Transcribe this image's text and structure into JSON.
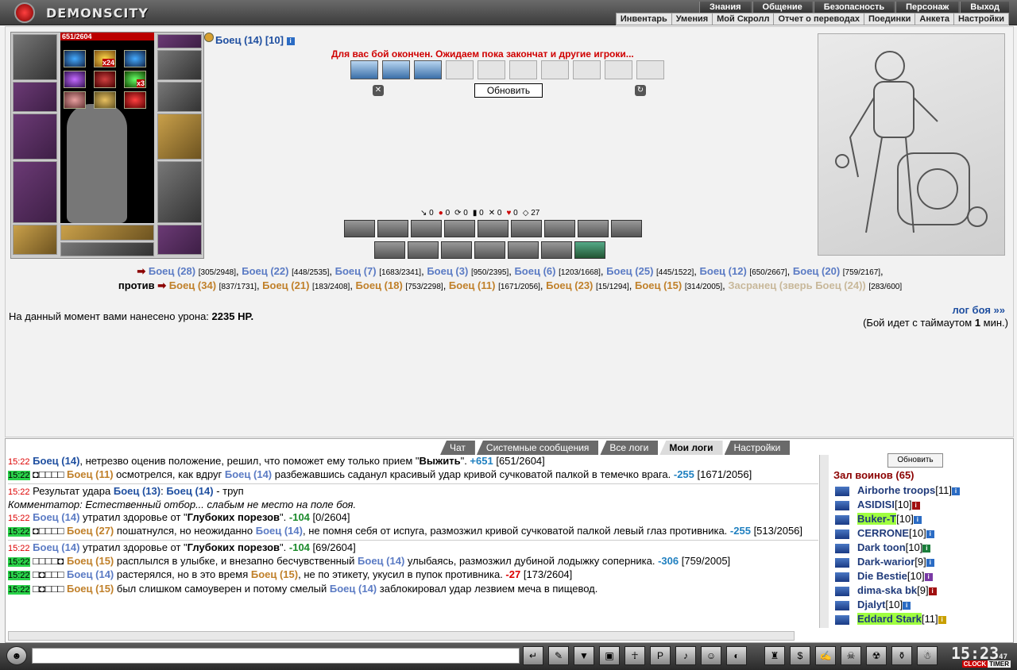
{
  "header": {
    "logo_text": "DEMONSCITY",
    "menu_top": [
      "Знания",
      "Общение",
      "Безопасность",
      "Персонаж",
      "Выход"
    ],
    "menu_bottom": [
      "Инвентарь",
      "Умения",
      "Мой Скролл",
      "Отчет о переводах",
      "Поединки",
      "Анкета",
      "Настройки"
    ]
  },
  "character": {
    "name": "Боец (14) [10]",
    "hp": "651/2604",
    "x24": "x24",
    "x3": "x3"
  },
  "battle": {
    "message": "Для вас бой окончен. Ожидаем пока закончат и другие игроки...",
    "refresh": "Обновить",
    "stats": [
      "0",
      "0",
      "0",
      "0",
      "0",
      "0",
      "27"
    ]
  },
  "teams": {
    "team1": [
      {
        "n": "Боец (28)",
        "h": "[305/2948]"
      },
      {
        "n": "Боец (22)",
        "h": "[448/2535]"
      },
      {
        "n": "Боец (7)",
        "h": "[1683/2341]"
      },
      {
        "n": "Боец (3)",
        "h": "[950/2395]"
      },
      {
        "n": "Боец (6)",
        "h": "[1203/1668]"
      },
      {
        "n": "Боец (25)",
        "h": "[445/1522]"
      },
      {
        "n": "Боец (12)",
        "h": "[650/2667]"
      },
      {
        "n": "Боец (20)",
        "h": "[759/2167]"
      }
    ],
    "versus": "против",
    "team2": [
      {
        "n": "Боец (34)",
        "h": "[837/1731]"
      },
      {
        "n": "Боец (21)",
        "h": "[183/2408]"
      },
      {
        "n": "Боец (18)",
        "h": "[753/2298]"
      },
      {
        "n": "Боец (11)",
        "h": "[1671/2056]"
      },
      {
        "n": "Боец (23)",
        "h": "[15/1294]"
      },
      {
        "n": "Боец (15)",
        "h": "[314/2005]"
      }
    ],
    "beast": {
      "n": "Засранец (зверь Боец (24))",
      "h": "[283/600]"
    }
  },
  "damage": {
    "label": "На данный момент вами нанесено урона:",
    "value": "2235 HP."
  },
  "log_link": "лог боя »»",
  "timeout": {
    "pre": "(Бой идет с таймаутом",
    "num": "1",
    "post": "мин.)"
  },
  "tabs": [
    "Чат",
    "Системные сообщения",
    "Все логи",
    "Мои логи",
    "Настройки"
  ],
  "chat": [
    {
      "t": "15:22",
      "g": false,
      "html": "<span class='b2'>Боец (14)</span>, нетрезво оценив положение, решил, что поможет ему только прием \"<span class='k'>Выжить</span>\". <span class='neg'>+651</span> [651/2604]"
    },
    {
      "t": "15:22",
      "g": true,
      "html": "◘□□□□ <span class='o'>Боец (11)</span> осмотрелся, как вдруг <span class='b'>Боец (14)</span> разбежавшись саданул красивый удар кривой сучковатой палкой в темечко врага. <span class='neg'>-255</span> [1671/2056]",
      "sep": true
    },
    {
      "t": "15:22",
      "g": false,
      "html": "Результат удара <span class='b2'>Боец (13)</span>: <span class='b2'>Боец (14)</span> - труп<br><i>Комментатор: Естественный отбор... слабым не место на поле боя.</i>"
    },
    {
      "t": "15:22",
      "g": false,
      "html": "<span class='b'>Боец (14)</span> утратил здоровье от \"<span class='k'>Глубоких порезов</span>\". <span class='pos'>-104</span> [0/2604]"
    },
    {
      "t": "15:22",
      "g": true,
      "html": "◘□□□□ <span class='o'>Боец (27)</span> пошатнулся, но неожиданно <span class='b'>Боец (14)</span>, не помня себя от испуга, размозжил кривой сучковатой палкой левый глаз противника. <span class='neg'>-255</span> [513/2056]",
      "sep": true
    },
    {
      "t": "15:22",
      "g": false,
      "html": "<span class='b'>Боец (14)</span> утратил здоровье от \"<span class='k'>Глубоких порезов</span>\". <span class='pos'>-104</span> [69/2604]"
    },
    {
      "t": "15:22",
      "g": true,
      "html": "□□□□◘ <span class='o'>Боец (15)</span> расплылся в улыбке, и внезапно бесчувственный <span class='b'>Боец (14)</span> улыбаясь, размозжил дубиной лодыжку соперника. <span class='neg'>-306</span> [759/2005]"
    },
    {
      "t": "15:22",
      "g": true,
      "html": "□◘□□□ <span class='b'>Боец (14)</span> растерялся, но в это время <span class='o'>Боец (15)</span>, не по этикету, укусил в пупок противника. <span class='negr'>-27</span> [173/2604]"
    },
    {
      "t": "15:22",
      "g": true,
      "html": "□◘□□□ <span class='o'>Боец (15)</span> был слишком самоуверен и потому смелый <span class='b'>Боец (14)</span> заблокировал удар лезвием меча в пищевод."
    }
  ],
  "side": {
    "refresh": "Обновить",
    "hall": "Зал воинов (65)",
    "players": [
      {
        "n": "Airborhe troops",
        "l": "[11]",
        "i": ""
      },
      {
        "n": "ASIDISI",
        "l": "[10]",
        "i": "red"
      },
      {
        "n": "Buker-T",
        "l": "[10]",
        "i": "",
        "hl": true
      },
      {
        "n": "CERRONE",
        "l": "[10]",
        "i": ""
      },
      {
        "n": "Dark toon",
        "l": "[10]",
        "i": "green"
      },
      {
        "n": "Dark-warior",
        "l": "[9]",
        "i": ""
      },
      {
        "n": "Die Bestie",
        "l": "[10]",
        "i": "purple"
      },
      {
        "n": "dima-ska bk",
        "l": "[9]",
        "i": "red"
      },
      {
        "n": "Djalyt",
        "l": "[10]",
        "i": ""
      },
      {
        "n": "Eddard Stark",
        "l": "[11]",
        "i": "yellow",
        "hl": true
      }
    ]
  },
  "clock": {
    "time": "15:23",
    "sec": "47",
    "l1": "CLOCK",
    "l2": "TIMER"
  }
}
